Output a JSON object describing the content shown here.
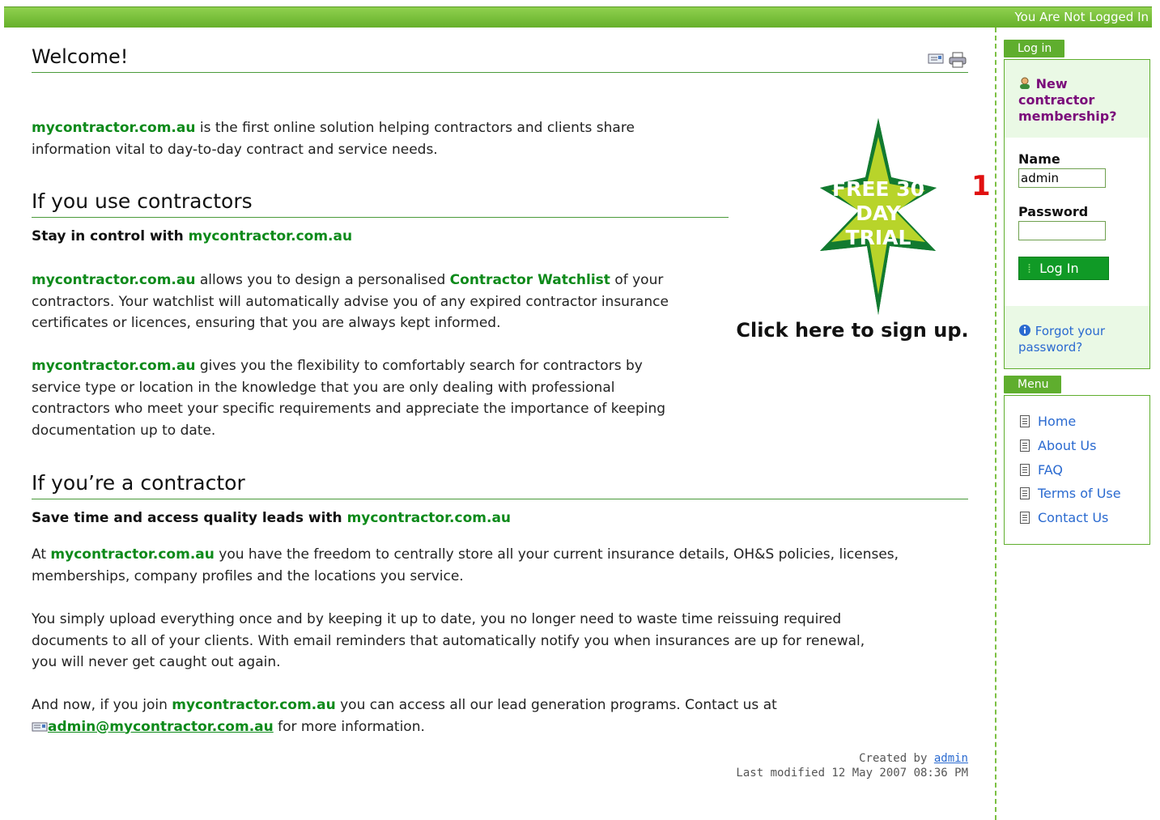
{
  "topbar": {
    "status": "You Are Not Logged In"
  },
  "page": {
    "title": "Welcome!",
    "brand": "mycontractor.com.au",
    "intro_rest_1": " is the first online solution helping contractors and clients share",
    "intro_rest_2": "information vital to day-to-day contract and service needs.",
    "section1": {
      "heading": "If you use contractors",
      "subheading": "Stay in control with ",
      "p1_mid": " allows you to design a personalised ",
      "watchlist": "Contractor Watchlist",
      "p1_rest": " of your",
      "p1_line2": "contractors.  Your watchlist will automatically advise you of any expired contractor insurance",
      "p1_line3": "certificates or licences, ensuring that you are always kept informed.",
      "p2_mid": " gives you the flexibility to comfortably search for contractors by",
      "p2_line2": "service type or location in the knowledge that you are only dealing with professional",
      "p2_line3": "contractors who meet your specific requirements and appreciate the importance of keeping",
      "p2_line4": "documentation up to date."
    },
    "section2": {
      "heading": "If you’re a contractor",
      "subheading": "Save time and access quality leads with ",
      "p1_pre": "At ",
      "p1_rest": " you have the freedom to centrally store all your current insurance details, OH&S policies, licenses,",
      "p1_line2": "memberships, company profiles and the locations you service.",
      "p2_line1": "You simply upload everything once and by keeping it up to date, you no longer need to waste time reissuing required",
      "p2_line2": "documents to all of your clients. With email reminders that automatically notify you when insurances are up for renewal,",
      "p2_line3": "you will never get caught out again.",
      "p3_pre": "And now, if you join ",
      "p3_rest": " you can access all our lead generation programs. Contact us at",
      "email": "admin@mycontractor.com.au",
      "p3_end": " for more information."
    },
    "promo": {
      "star_text": [
        "FREE 30",
        "DAY",
        "TRIAL"
      ],
      "cta": "Click here to sign up."
    },
    "footer": {
      "created_by": "Created by ",
      "author": "admin",
      "modified": "Last modified 12 May 2007 08:36 PM"
    }
  },
  "annotation": {
    "marker": "1"
  },
  "login": {
    "tab": "Log in",
    "new_membership": [
      "New",
      "contractor",
      "membership?"
    ],
    "name_label": "Name",
    "name_value": "admin",
    "password_label": "Password",
    "password_value": "",
    "button": "Log In",
    "forgot": [
      "Forgot your",
      "password?"
    ]
  },
  "menu": {
    "tab": "Menu",
    "items": [
      "Home",
      "About Us",
      "FAQ",
      "Terms of Use",
      "Contact Us"
    ]
  },
  "colors": {
    "brand_green": "#0d8a1a",
    "bar_green": "#66b02a",
    "link_blue": "#2a6ad0",
    "purple": "#7a0a7a"
  }
}
